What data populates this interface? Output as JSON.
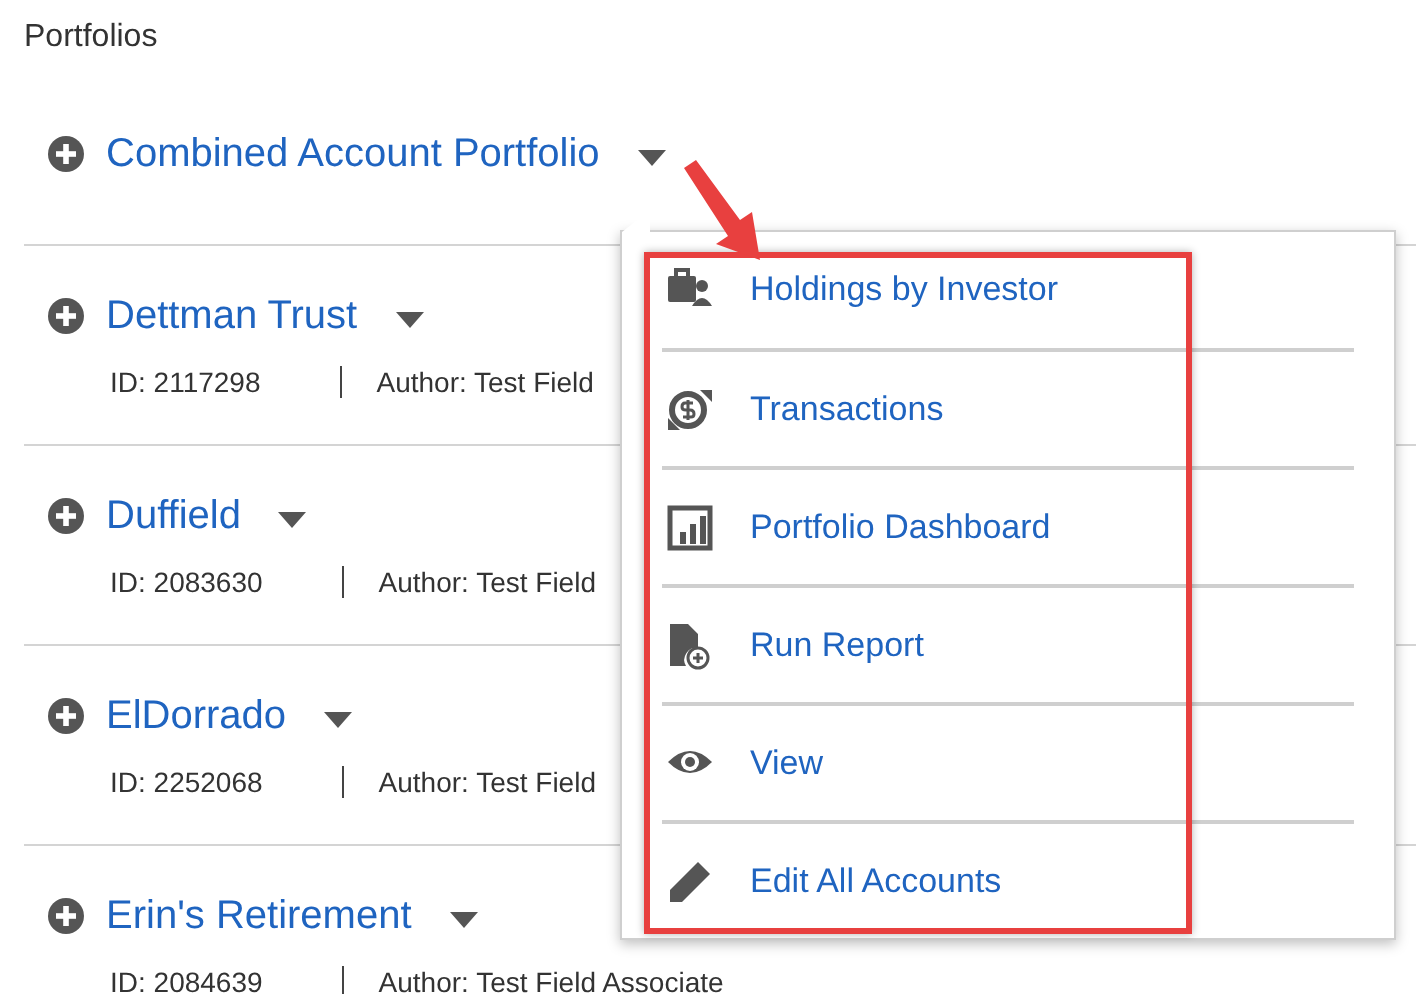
{
  "heading": "Portfolios",
  "portfolios": [
    {
      "name": "Combined Account Portfolio"
    },
    {
      "name": "Dettman Trust",
      "id": "ID: 2117298",
      "author": "Author: Test Field"
    },
    {
      "name": "Duffield",
      "id": "ID: 2083630",
      "author": "Author: Test Field"
    },
    {
      "name": "ElDorrado",
      "id": "ID: 2252068",
      "author": "Author: Test Field"
    },
    {
      "name": "Erin's Retirement",
      "id": "ID: 2084639",
      "author": "Author: Test Field Associate"
    }
  ],
  "menu": {
    "items": [
      {
        "label": "Holdings by Investor",
        "kind": "holdings"
      },
      {
        "label": "Transactions",
        "kind": "transactions"
      },
      {
        "label": "Portfolio Dashboard",
        "kind": "dashboard"
      },
      {
        "label": "Run Report",
        "kind": "report"
      },
      {
        "label": "View",
        "kind": "view"
      },
      {
        "label": "Edit All Accounts",
        "kind": "edit"
      }
    ]
  }
}
